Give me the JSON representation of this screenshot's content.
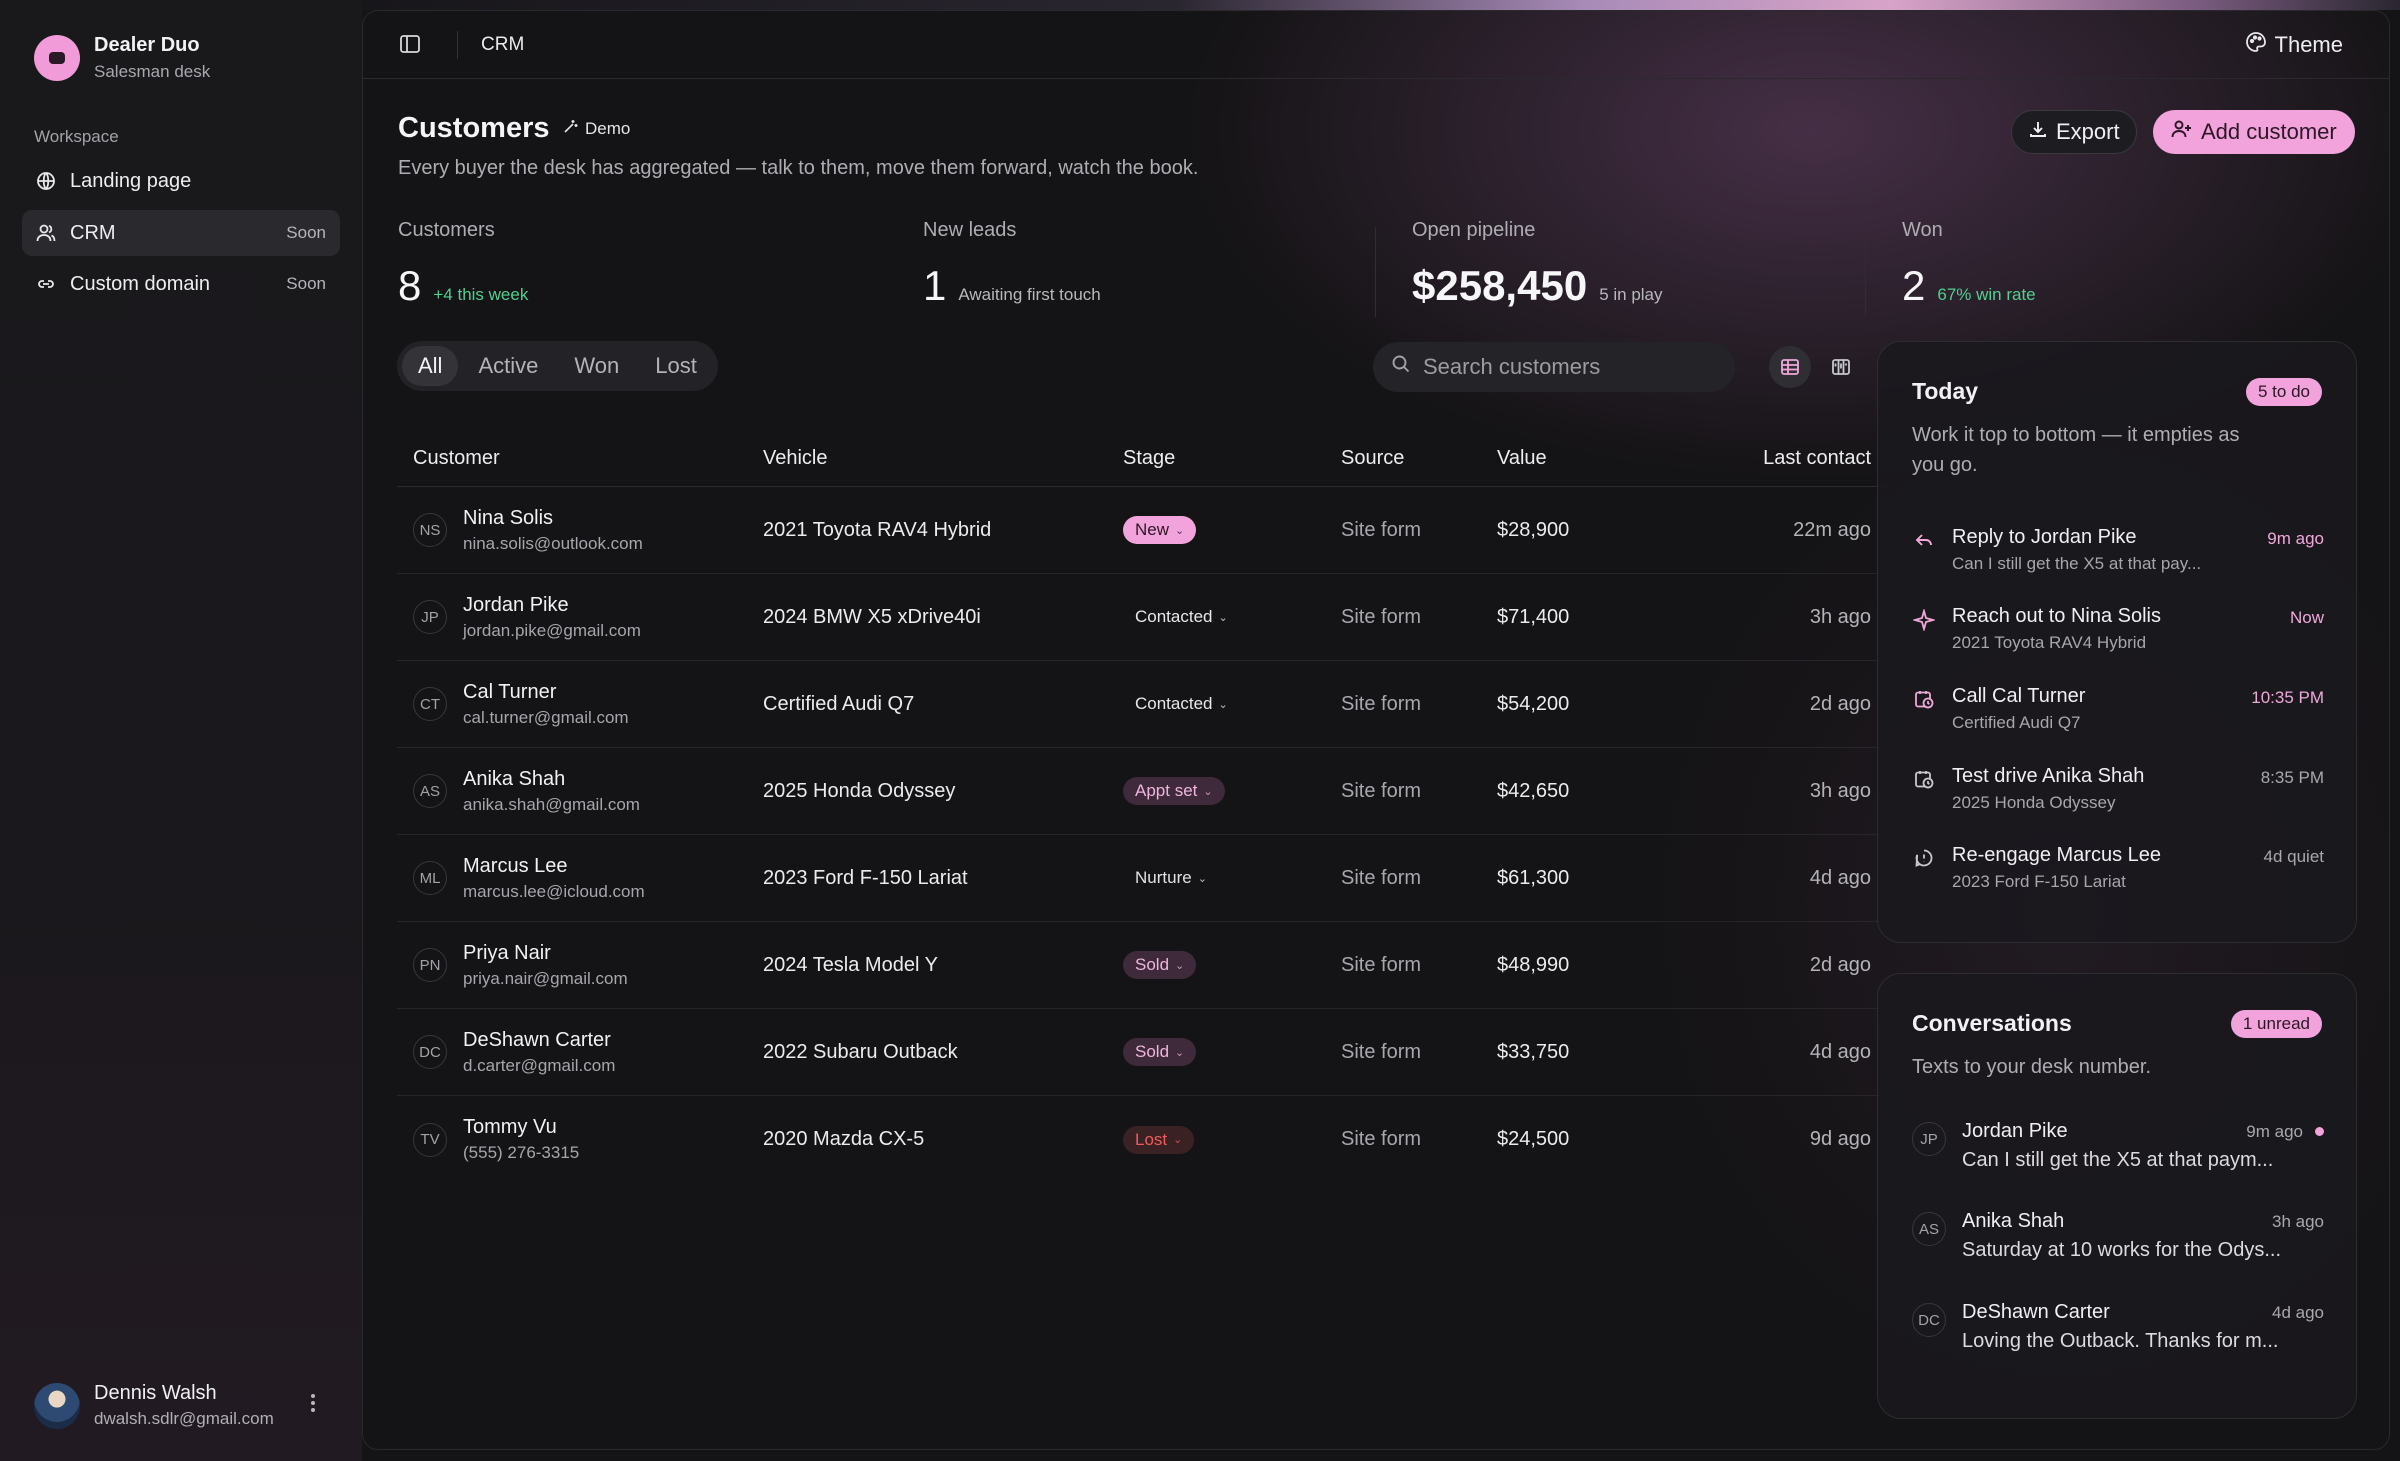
{
  "brand": {
    "name": "Dealer Duo",
    "subtitle": "Salesman desk"
  },
  "sidebar": {
    "section_label": "Workspace",
    "items": [
      {
        "label": "Landing page",
        "icon": "globe-icon",
        "badge": ""
      },
      {
        "label": "CRM",
        "icon": "users-icon",
        "badge": "Soon"
      },
      {
        "label": "Custom domain",
        "icon": "link-icon",
        "badge": "Soon"
      }
    ]
  },
  "user": {
    "name": "Dennis Walsh",
    "email": "dwalsh.sdlr@gmail.com"
  },
  "topbar": {
    "breadcrumb": "CRM",
    "theme_label": "Theme"
  },
  "page": {
    "title": "Customers",
    "demo_label": "Demo",
    "subtitle": "Every buyer the desk has aggregated — talk to them, move them forward, watch the book.",
    "export_label": "Export",
    "add_label": "Add customer"
  },
  "stats": [
    {
      "label": "Customers",
      "value": "8",
      "note": "+4 this week"
    },
    {
      "label": "New leads",
      "value": "1",
      "note": "Awaiting first touch"
    },
    {
      "label": "Open pipeline",
      "value": "$258,450",
      "note": "5 in play"
    },
    {
      "label": "Won",
      "value": "2",
      "note": "67% win rate"
    }
  ],
  "filters": [
    "All",
    "Active",
    "Won",
    "Lost"
  ],
  "active_filter": "All",
  "search": {
    "placeholder": "Search customers"
  },
  "table": {
    "columns": [
      "Customer",
      "Vehicle",
      "Stage",
      "Source",
      "Value",
      "Last contact"
    ],
    "rows": [
      {
        "initials": "NS",
        "name": "Nina Solis",
        "email": "nina.solis@outlook.com",
        "vehicle": "2021 Toyota RAV4 Hybrid",
        "stage": "New",
        "source": "Site form",
        "value": "$28,900",
        "last": "22m ago"
      },
      {
        "initials": "JP",
        "name": "Jordan Pike",
        "email": "jordan.pike@gmail.com",
        "vehicle": "2024 BMW X5 xDrive40i",
        "stage": "Contacted",
        "source": "Site form",
        "value": "$71,400",
        "last": "3h ago"
      },
      {
        "initials": "CT",
        "name": "Cal Turner",
        "email": "cal.turner@gmail.com",
        "vehicle": "Certified Audi Q7",
        "stage": "Contacted",
        "source": "Site form",
        "value": "$54,200",
        "last": "2d ago"
      },
      {
        "initials": "AS",
        "name": "Anika Shah",
        "email": "anika.shah@gmail.com",
        "vehicle": "2025 Honda Odyssey",
        "stage": "Appt set",
        "source": "Site form",
        "value": "$42,650",
        "last": "3h ago"
      },
      {
        "initials": "ML",
        "name": "Marcus Lee",
        "email": "marcus.lee@icloud.com",
        "vehicle": "2023 Ford F-150 Lariat",
        "stage": "Nurture",
        "source": "Site form",
        "value": "$61,300",
        "last": "4d ago"
      },
      {
        "initials": "PN",
        "name": "Priya Nair",
        "email": "priya.nair@gmail.com",
        "vehicle": "2024 Tesla Model Y",
        "stage": "Sold",
        "source": "Site form",
        "value": "$48,990",
        "last": "2d ago"
      },
      {
        "initials": "DC",
        "name": "DeShawn Carter",
        "email": "d.carter@gmail.com",
        "vehicle": "2022 Subaru Outback",
        "stage": "Sold",
        "source": "Site form",
        "value": "$33,750",
        "last": "4d ago"
      },
      {
        "initials": "TV",
        "name": "Tommy Vu",
        "email": "(555) 276-3315",
        "vehicle": "2020 Mazda CX-5",
        "stage": "Lost",
        "source": "Site form",
        "value": "$24,500",
        "last": "9d ago"
      }
    ]
  },
  "today": {
    "title": "Today",
    "badge": "5 to do",
    "subtitle": "Work it top to bottom — it empties as you go.",
    "tasks": [
      {
        "icon": "reply-icon",
        "title": "Reply to Jordan Pike",
        "detail": "Can I still get the X5 at that pay...",
        "time": "9m ago",
        "accent": true
      },
      {
        "icon": "sparkle-icon",
        "title": "Reach out to Nina Solis",
        "detail": "2021 Toyota RAV4 Hybrid",
        "time": "Now",
        "accent": true
      },
      {
        "icon": "calendar-clock-icon",
        "title": "Call Cal Turner",
        "detail": "Certified Audi Q7",
        "time": "10:35 PM",
        "accent": true
      },
      {
        "icon": "calendar-clock-icon",
        "title": "Test drive Anika Shah",
        "detail": "2025 Honda Odyssey",
        "time": "8:35 PM",
        "accent": false
      },
      {
        "icon": "alert-circle-icon",
        "title": "Re-engage Marcus Lee",
        "detail": "2023 Ford F-150 Lariat",
        "time": "4d quiet",
        "accent": false
      }
    ]
  },
  "conversations": {
    "title": "Conversations",
    "badge": "1 unread",
    "subtitle": "Texts to your desk number.",
    "items": [
      {
        "initials": "JP",
        "name": "Jordan Pike",
        "time": "9m ago",
        "message": "Can I still get the X5 at that paym...",
        "unread": true
      },
      {
        "initials": "AS",
        "name": "Anika Shah",
        "time": "3h ago",
        "message": "Saturday at 10 works for the Odys...",
        "unread": false
      },
      {
        "initials": "DC",
        "name": "DeShawn Carter",
        "time": "4d ago",
        "message": "Loving the Outback. Thanks for m...",
        "unread": false
      }
    ]
  },
  "colors": {
    "accent": "#f3a3dc",
    "positive": "#4fd08f",
    "danger": "#ef5b5b",
    "background": "#141315"
  }
}
